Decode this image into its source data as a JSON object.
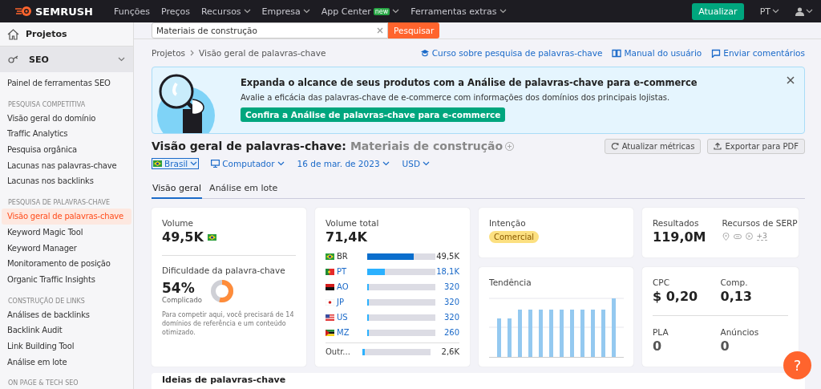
{
  "topnav": {
    "logo": "SEMRUSH",
    "items": [
      {
        "label": "Funções",
        "kind": "link"
      },
      {
        "label": "Preços",
        "kind": "link"
      },
      {
        "label": "Recursos",
        "kind": "menu"
      },
      {
        "label": "Empresa",
        "kind": "menu"
      },
      {
        "label": "App Center",
        "kind": "menu",
        "badge": "new"
      },
      {
        "label": "Ferramentas extras",
        "kind": "menu"
      }
    ],
    "upgrade": "Atualizar",
    "language": "PT"
  },
  "sidebar": {
    "projects": "Projetos",
    "section": {
      "label": "SEO",
      "expanded": true
    },
    "groups": [
      {
        "items": [
          {
            "label": "Painel de ferramentas SEO",
            "selected": false
          }
        ]
      },
      {
        "heading": "PESQUISA COMPETITIVA",
        "items": [
          {
            "label": "Visão geral do domínio",
            "selected": false
          },
          {
            "label": "Traffic Analytics",
            "selected": false
          },
          {
            "label": "Pesquisa orgânica",
            "selected": false
          },
          {
            "label": "Lacunas nas palavras-chave",
            "selected": false
          },
          {
            "label": "Lacunas nos backlinks",
            "selected": false
          }
        ]
      },
      {
        "heading": "PESQUISA DE PALAVRAS-CHAVE",
        "items": [
          {
            "label": "Visão geral de palavras-chave",
            "selected": true
          },
          {
            "label": "Keyword Magic Tool",
            "selected": false
          },
          {
            "label": "Keyword Manager",
            "selected": false
          },
          {
            "label": "Monitoramento de posição",
            "selected": false
          },
          {
            "label": "Organic Traffic Insights",
            "selected": false
          }
        ]
      },
      {
        "heading": "CONSTRUÇÃO DE LINKS",
        "items": [
          {
            "label": "Análises de backlinks",
            "selected": false
          },
          {
            "label": "Backlink Audit",
            "selected": false
          },
          {
            "label": "Link Building Tool",
            "selected": false
          },
          {
            "label": "Análise em lote",
            "selected": false
          }
        ]
      },
      {
        "heading": "ON PAGE & TECH SEO"
      }
    ]
  },
  "search": {
    "value": "Materiais de construção",
    "button": "Pesquisar"
  },
  "breadcrumb": [
    "Projetos",
    "Visão geral de palavras-chave"
  ],
  "help_links": [
    {
      "label": "Curso sobre pesquisa de palavras-chave",
      "kind": "course"
    },
    {
      "label": "Manual do usuário",
      "kind": "manual"
    },
    {
      "label": "Enviar comentários",
      "kind": "feedback"
    }
  ],
  "banner": {
    "title": "Expanda o alcance de seus produtos com a Análise de palavras-chave para e-commerce",
    "text": "Avalie a eficácia das palavras-chave de e-commerce com informações dos domínios dos principais lojistas.",
    "button": "Confira a Análise de palavras-chave para e-commerce"
  },
  "page_title": {
    "label": "Visão geral de palavras-chave:",
    "keyword": "Materiais de construção"
  },
  "actions": [
    "Atualizar métricas",
    "Exportar para PDF"
  ],
  "filters": [
    {
      "label": "Brasil",
      "kind": "country"
    },
    {
      "label": "Computador",
      "kind": "device"
    },
    {
      "label": "16 de mar. de 2023",
      "kind": "date"
    },
    {
      "label": "USD",
      "kind": "currency"
    }
  ],
  "tabs": [
    {
      "label": "Visão geral",
      "selected": true
    },
    {
      "label": "Análise em lote",
      "selected": false
    }
  ],
  "volume": {
    "label": "Volume",
    "value": "49,5K"
  },
  "difficulty": {
    "label": "Dificuldade da palavra-chave",
    "value": "54%",
    "level": 0.54,
    "rating": "Complicado",
    "note": "Para competir aqui, você precisará de 14 domínios de referência e um conteúdo otimizado."
  },
  "total_volume": {
    "label": "Volume total",
    "value": "71,4K",
    "countries": [
      {
        "code": "BR",
        "value": "49,5K",
        "level": 0.68,
        "selected": true,
        "kind": "country"
      },
      {
        "code": "PT",
        "value": "18,1K",
        "level": 0.26,
        "selected": false,
        "kind": "country"
      },
      {
        "code": "AO",
        "value": "320",
        "level": 0.02,
        "selected": false,
        "kind": "country"
      },
      {
        "code": "JP",
        "value": "320",
        "level": 0.02,
        "selected": false,
        "kind": "country"
      },
      {
        "code": "US",
        "value": "320",
        "level": 0.02,
        "selected": false,
        "kind": "country"
      },
      {
        "code": "MZ",
        "value": "260",
        "level": 0.02,
        "selected": false,
        "kind": "country"
      },
      {
        "code": "Outr...",
        "value": "2,6K",
        "level": 0.03,
        "selected": false,
        "kind": "other"
      }
    ]
  },
  "intent": {
    "label": "Intenção",
    "tag": "Comercial"
  },
  "results": {
    "label": "Resultados",
    "value": "119,0M",
    "serp_label": "Recursos de SERP",
    "serp_more": "+3"
  },
  "trend": {
    "label": "Tendência"
  },
  "metrics": [
    {
      "label": "CPC",
      "value": "$ 0,20"
    },
    {
      "label": "Comp.",
      "value": "0,13"
    },
    {
      "label": "PLA",
      "value": "0"
    },
    {
      "label": "Anúncios",
      "value": "0"
    }
  ],
  "ideas": {
    "title": "Ideias de palavras-chave"
  },
  "help_button": "?"
}
